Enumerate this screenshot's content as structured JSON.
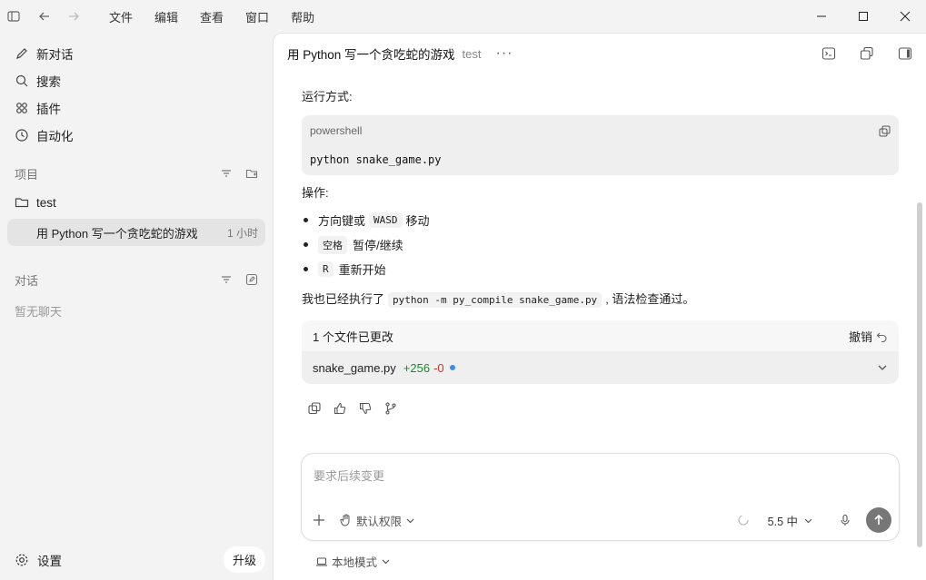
{
  "menu": [
    "文件",
    "编辑",
    "查看",
    "窗口",
    "帮助"
  ],
  "sidebar": {
    "nav": [
      {
        "label": "新对话",
        "icon": "edit-icon"
      },
      {
        "label": "搜索",
        "icon": "search-icon"
      },
      {
        "label": "插件",
        "icon": "grid-icon"
      },
      {
        "label": "自动化",
        "icon": "clock-icon"
      }
    ],
    "projects_title": "项目",
    "project_name": "test",
    "chat_title": "用 Python 写一个贪吃蛇的游戏",
    "chat_time": "1 小时",
    "conversations_title": "对话",
    "empty_text": "暂无聊天",
    "settings_label": "设置",
    "upgrade_label": "升级"
  },
  "topbar": {
    "title": "用 Python 写一个贪吃蛇的游戏",
    "project": "test",
    "more": "···"
  },
  "content": {
    "run_label": "运行方式:",
    "code_lang": "powershell",
    "code": "python snake_game.py",
    "ops_label": "操作:",
    "bullets": [
      {
        "code": "",
        "pre": "方向键或",
        "mid": "WASD",
        "post": "移动"
      },
      {
        "code": "空格",
        "text": "暂停/继续"
      },
      {
        "code": "R",
        "text": "重新开始"
      }
    ],
    "done_pre": "我也已经执行了",
    "done_code": "python -m py_compile snake_game.py",
    "done_post": ", 语法检查通过。"
  },
  "changes": {
    "header": "1 个文件已更改",
    "undo": "撤销",
    "file": "snake_game.py",
    "added": "+256",
    "removed": "-0"
  },
  "composer": {
    "placeholder": "要求后续变更",
    "permission": "默认权限",
    "model": "5.5 中"
  },
  "mode": "本地模式"
}
